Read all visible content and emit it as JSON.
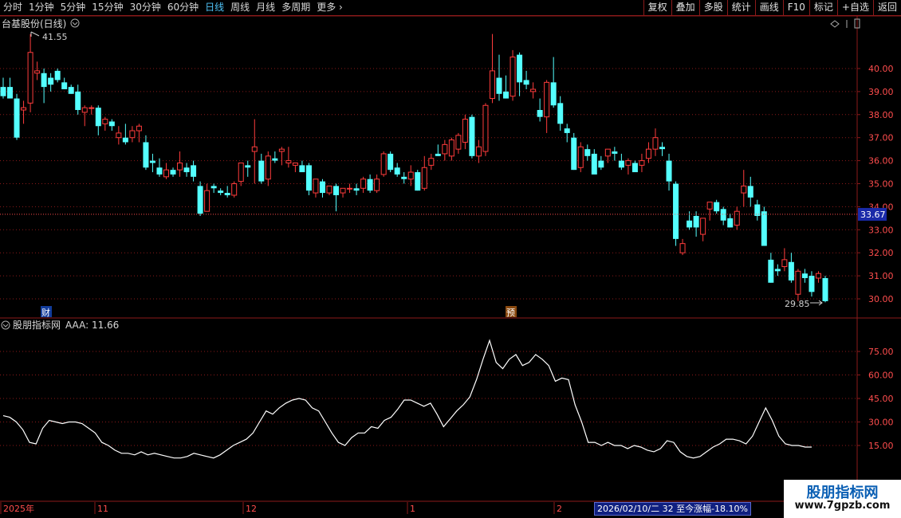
{
  "toolbar": {
    "periods": [
      "分时",
      "1分钟",
      "5分钟",
      "15分钟",
      "30分钟",
      "60分钟",
      "日线",
      "周线",
      "月线",
      "多周期",
      "更多"
    ],
    "active": "日线",
    "buttons": [
      "复权",
      "叠加",
      "多股",
      "统计",
      "画线",
      "F10",
      "标记",
      "+自选",
      "返回"
    ]
  },
  "main_chart": {
    "title": "台基股份(日线)",
    "max_label": "41.55",
    "min_label": "29.85",
    "current_price": "33.67",
    "flag_cai": "财",
    "flag_yu": "预"
  },
  "indicator": {
    "title": "股朋指标网",
    "value_label": "AAA: 11.66"
  },
  "xaxis": {
    "labels": [
      "2025年",
      "11",
      "12",
      "1",
      "2"
    ]
  },
  "status_text": "2026/02/10/二 32 至今涨幅-18.10%",
  "watermark": {
    "title": "股朋指标网",
    "url": "www.7gpzb.com"
  },
  "colors": {
    "up": "#ff3c3c",
    "down": "#54ffff",
    "grid": "#8b1a1a",
    "line": "#ffffff",
    "active_period": "#4fc3f7"
  },
  "chart_data": [
    {
      "type": "candlestick",
      "title": "台基股份(日线)",
      "ylim": [
        29.5,
        42.0
      ],
      "yticks": [
        "40.00",
        "39.00",
        "38.00",
        "37.00",
        "36.00",
        "35.00",
        "34.00",
        "33.00",
        "32.00",
        "31.00",
        "30.00"
      ],
      "candles": [
        {
          "o": 39.2,
          "h": 39.6,
          "l": 38.7,
          "c": 38.8
        },
        {
          "o": 39.2,
          "h": 39.6,
          "l": 38.9,
          "c": 38.7
        },
        {
          "o": 38.7,
          "h": 38.9,
          "l": 36.9,
          "c": 37.0
        },
        {
          "o": 38.2,
          "h": 38.6,
          "l": 37.6,
          "c": 38.3
        },
        {
          "o": 38.5,
          "h": 41.5,
          "l": 38.1,
          "c": 40.7
        },
        {
          "o": 39.8,
          "h": 40.3,
          "l": 39.5,
          "c": 39.9
        },
        {
          "o": 39.8,
          "h": 40.0,
          "l": 38.5,
          "c": 39.2
        },
        {
          "o": 39.6,
          "h": 39.8,
          "l": 39.0,
          "c": 39.3
        },
        {
          "o": 39.9,
          "h": 40.0,
          "l": 39.4,
          "c": 39.5
        },
        {
          "o": 39.4,
          "h": 39.6,
          "l": 39.1,
          "c": 39.1
        },
        {
          "o": 39.2,
          "h": 39.3,
          "l": 38.9,
          "c": 38.9
        },
        {
          "o": 39.0,
          "h": 39.3,
          "l": 38.0,
          "c": 38.2
        },
        {
          "o": 38.1,
          "h": 38.4,
          "l": 37.5,
          "c": 38.3
        },
        {
          "o": 38.3,
          "h": 38.4,
          "l": 38.0,
          "c": 38.3
        },
        {
          "o": 38.3,
          "h": 38.4,
          "l": 37.1,
          "c": 37.5
        },
        {
          "o": 37.6,
          "h": 37.9,
          "l": 37.3,
          "c": 37.8
        },
        {
          "o": 37.7,
          "h": 37.8,
          "l": 37.3,
          "c": 37.5
        },
        {
          "o": 37.0,
          "h": 37.5,
          "l": 36.7,
          "c": 37.2
        },
        {
          "o": 37.0,
          "h": 37.6,
          "l": 36.7,
          "c": 36.8
        },
        {
          "o": 37.0,
          "h": 37.5,
          "l": 36.8,
          "c": 37.3
        },
        {
          "o": 37.3,
          "h": 37.6,
          "l": 36.8,
          "c": 37.5
        },
        {
          "o": 36.8,
          "h": 37.1,
          "l": 35.6,
          "c": 35.7
        },
        {
          "o": 36.0,
          "h": 36.3,
          "l": 35.5,
          "c": 35.9
        },
        {
          "o": 35.7,
          "h": 36.1,
          "l": 35.3,
          "c": 35.4
        },
        {
          "o": 35.3,
          "h": 35.9,
          "l": 35.2,
          "c": 35.6
        },
        {
          "o": 35.6,
          "h": 35.7,
          "l": 35.3,
          "c": 35.4
        },
        {
          "o": 35.6,
          "h": 36.4,
          "l": 35.3,
          "c": 35.9
        },
        {
          "o": 35.7,
          "h": 35.9,
          "l": 35.3,
          "c": 35.5
        },
        {
          "o": 35.8,
          "h": 36.0,
          "l": 35.1,
          "c": 35.3
        },
        {
          "o": 34.9,
          "h": 35.1,
          "l": 33.6,
          "c": 33.7
        },
        {
          "o": 33.8,
          "h": 35.0,
          "l": 33.8,
          "c": 34.7
        },
        {
          "o": 34.9,
          "h": 35.0,
          "l": 34.6,
          "c": 34.8
        },
        {
          "o": 34.7,
          "h": 34.8,
          "l": 34.5,
          "c": 34.6
        },
        {
          "o": 34.6,
          "h": 34.9,
          "l": 34.4,
          "c": 34.5
        },
        {
          "o": 34.5,
          "h": 35.1,
          "l": 34.4,
          "c": 35.0
        },
        {
          "o": 35.1,
          "h": 35.9,
          "l": 34.9,
          "c": 35.9
        },
        {
          "o": 35.8,
          "h": 36.0,
          "l": 35.3,
          "c": 35.7
        },
        {
          "o": 36.4,
          "h": 37.8,
          "l": 35.0,
          "c": 36.6
        },
        {
          "o": 36.0,
          "h": 36.3,
          "l": 35.0,
          "c": 35.1
        },
        {
          "o": 35.2,
          "h": 36.4,
          "l": 34.9,
          "c": 36.2
        },
        {
          "o": 36.1,
          "h": 36.4,
          "l": 35.9,
          "c": 36.0
        },
        {
          "o": 36.4,
          "h": 36.6,
          "l": 35.8,
          "c": 36.5
        },
        {
          "o": 35.9,
          "h": 36.6,
          "l": 35.7,
          "c": 36.0
        },
        {
          "o": 35.8,
          "h": 35.9,
          "l": 35.5,
          "c": 35.9
        },
        {
          "o": 35.8,
          "h": 36.0,
          "l": 35.6,
          "c": 35.5
        },
        {
          "o": 35.8,
          "h": 35.9,
          "l": 34.5,
          "c": 34.7
        },
        {
          "o": 34.6,
          "h": 34.8,
          "l": 34.4,
          "c": 35.2
        },
        {
          "o": 35.1,
          "h": 35.2,
          "l": 34.4,
          "c": 34.6
        },
        {
          "o": 34.6,
          "h": 34.9,
          "l": 34.5,
          "c": 34.9
        },
        {
          "o": 34.9,
          "h": 35.0,
          "l": 33.8,
          "c": 34.5
        },
        {
          "o": 34.6,
          "h": 34.8,
          "l": 34.4,
          "c": 34.8
        },
        {
          "o": 34.8,
          "h": 35.0,
          "l": 34.6,
          "c": 34.8
        },
        {
          "o": 34.8,
          "h": 35.0,
          "l": 34.5,
          "c": 34.7
        },
        {
          "o": 34.8,
          "h": 35.3,
          "l": 34.6,
          "c": 35.2
        },
        {
          "o": 35.2,
          "h": 35.4,
          "l": 34.6,
          "c": 34.7
        },
        {
          "o": 34.7,
          "h": 35.4,
          "l": 34.6,
          "c": 35.2
        },
        {
          "o": 35.4,
          "h": 36.4,
          "l": 35.3,
          "c": 36.3
        },
        {
          "o": 36.3,
          "h": 36.4,
          "l": 35.5,
          "c": 35.6
        },
        {
          "o": 35.7,
          "h": 35.9,
          "l": 35.3,
          "c": 35.4
        },
        {
          "o": 35.3,
          "h": 35.5,
          "l": 35.0,
          "c": 35.2
        },
        {
          "o": 35.2,
          "h": 35.8,
          "l": 34.9,
          "c": 35.5
        },
        {
          "o": 35.5,
          "h": 35.6,
          "l": 34.7,
          "c": 34.7
        },
        {
          "o": 34.8,
          "h": 36.2,
          "l": 34.7,
          "c": 35.7
        },
        {
          "o": 35.8,
          "h": 36.3,
          "l": 35.6,
          "c": 36.1
        },
        {
          "o": 36.3,
          "h": 36.7,
          "l": 36.2,
          "c": 36.2
        },
        {
          "o": 36.3,
          "h": 36.9,
          "l": 36.0,
          "c": 36.7
        },
        {
          "o": 36.2,
          "h": 37.0,
          "l": 36.0,
          "c": 36.9
        },
        {
          "o": 36.5,
          "h": 37.2,
          "l": 36.3,
          "c": 37.1
        },
        {
          "o": 36.8,
          "h": 38.0,
          "l": 36.5,
          "c": 37.8
        },
        {
          "o": 37.9,
          "h": 38.0,
          "l": 36.1,
          "c": 36.2
        },
        {
          "o": 36.2,
          "h": 36.9,
          "l": 35.9,
          "c": 36.6
        },
        {
          "o": 36.4,
          "h": 38.5,
          "l": 36.2,
          "c": 38.4
        },
        {
          "o": 38.7,
          "h": 41.5,
          "l": 38.5,
          "c": 39.9
        },
        {
          "o": 39.6,
          "h": 40.6,
          "l": 38.6,
          "c": 38.9
        },
        {
          "o": 39.0,
          "h": 39.7,
          "l": 38.7,
          "c": 38.7
        },
        {
          "o": 38.8,
          "h": 40.8,
          "l": 38.6,
          "c": 40.5
        },
        {
          "o": 40.6,
          "h": 40.7,
          "l": 38.8,
          "c": 39.4
        },
        {
          "o": 39.5,
          "h": 39.9,
          "l": 39.1,
          "c": 39.3
        },
        {
          "o": 39.0,
          "h": 39.4,
          "l": 38.7,
          "c": 39.1
        },
        {
          "o": 38.2,
          "h": 38.7,
          "l": 37.7,
          "c": 37.9
        },
        {
          "o": 37.9,
          "h": 39.5,
          "l": 37.2,
          "c": 39.4
        },
        {
          "o": 39.4,
          "h": 40.5,
          "l": 38.3,
          "c": 38.4
        },
        {
          "o": 38.5,
          "h": 38.8,
          "l": 37.3,
          "c": 37.6
        },
        {
          "o": 37.4,
          "h": 37.6,
          "l": 36.8,
          "c": 37.2
        },
        {
          "o": 37.0,
          "h": 37.2,
          "l": 35.6,
          "c": 35.6
        },
        {
          "o": 35.7,
          "h": 36.8,
          "l": 35.5,
          "c": 36.6
        },
        {
          "o": 36.5,
          "h": 36.7,
          "l": 36.0,
          "c": 36.2
        },
        {
          "o": 36.3,
          "h": 36.5,
          "l": 35.5,
          "c": 35.4
        },
        {
          "o": 36.0,
          "h": 36.2,
          "l": 35.6,
          "c": 35.7
        },
        {
          "o": 36.2,
          "h": 36.5,
          "l": 35.9,
          "c": 36.5
        },
        {
          "o": 36.4,
          "h": 36.6,
          "l": 36.0,
          "c": 36.3
        },
        {
          "o": 36.0,
          "h": 36.3,
          "l": 35.6,
          "c": 35.7
        },
        {
          "o": 35.8,
          "h": 36.1,
          "l": 35.4,
          "c": 36.0
        },
        {
          "o": 35.9,
          "h": 36.0,
          "l": 35.6,
          "c": 35.5
        },
        {
          "o": 35.8,
          "h": 36.3,
          "l": 35.5,
          "c": 36.0
        },
        {
          "o": 36.1,
          "h": 36.8,
          "l": 35.9,
          "c": 36.5
        },
        {
          "o": 36.5,
          "h": 37.4,
          "l": 36.2,
          "c": 37.0
        },
        {
          "o": 36.6,
          "h": 36.8,
          "l": 36.2,
          "c": 36.5
        },
        {
          "o": 36.0,
          "h": 36.3,
          "l": 34.7,
          "c": 35.1
        },
        {
          "o": 35.0,
          "h": 35.1,
          "l": 32.3,
          "c": 32.6
        },
        {
          "o": 32.0,
          "h": 32.6,
          "l": 31.9,
          "c": 32.4
        },
        {
          "o": 33.4,
          "h": 33.8,
          "l": 33.0,
          "c": 33.1
        },
        {
          "o": 33.6,
          "h": 33.8,
          "l": 32.7,
          "c": 33.1
        },
        {
          "o": 32.8,
          "h": 33.4,
          "l": 32.5,
          "c": 33.5
        },
        {
          "o": 33.9,
          "h": 34.1,
          "l": 33.4,
          "c": 34.2
        },
        {
          "o": 34.2,
          "h": 34.3,
          "l": 33.7,
          "c": 33.8
        },
        {
          "o": 33.9,
          "h": 34.0,
          "l": 33.2,
          "c": 33.4
        },
        {
          "o": 33.5,
          "h": 33.7,
          "l": 33.1,
          "c": 33.1
        },
        {
          "o": 33.2,
          "h": 34.0,
          "l": 33.0,
          "c": 33.8
        },
        {
          "o": 34.6,
          "h": 35.6,
          "l": 34.0,
          "c": 34.9
        },
        {
          "o": 34.9,
          "h": 35.3,
          "l": 34.0,
          "c": 34.4
        },
        {
          "o": 34.1,
          "h": 34.3,
          "l": 33.4,
          "c": 33.6
        },
        {
          "o": 33.8,
          "h": 34.0,
          "l": 32.3,
          "c": 32.3
        },
        {
          "o": 31.7,
          "h": 32.0,
          "l": 30.7,
          "c": 30.7
        },
        {
          "o": 31.3,
          "h": 31.5,
          "l": 31.0,
          "c": 31.2
        },
        {
          "o": 31.4,
          "h": 32.2,
          "l": 31.2,
          "c": 31.7
        },
        {
          "o": 31.6,
          "h": 32.0,
          "l": 30.7,
          "c": 30.8
        },
        {
          "o": 30.2,
          "h": 31.3,
          "l": 29.9,
          "c": 31.2
        },
        {
          "o": 31.1,
          "h": 31.3,
          "l": 30.7,
          "c": 30.9
        },
        {
          "o": 31.0,
          "h": 31.2,
          "l": 30.1,
          "c": 30.3
        },
        {
          "o": 30.9,
          "h": 31.2,
          "l": 30.7,
          "c": 31.1
        },
        {
          "o": 30.9,
          "h": 31.0,
          "l": 29.85,
          "c": 29.9
        }
      ]
    },
    {
      "type": "line",
      "title": "股朋指标网",
      "series": [
        {
          "name": "AAA",
          "values": [
            34,
            33,
            30,
            25,
            17,
            16,
            26,
            31,
            30,
            29,
            30,
            30,
            29,
            26,
            23,
            17,
            15,
            12,
            10,
            10,
            9,
            11,
            9,
            10,
            9,
            8,
            7,
            7,
            8,
            10,
            9,
            8,
            7,
            9,
            12,
            15,
            17,
            19,
            23,
            30,
            37,
            35,
            39,
            42,
            44,
            45,
            44,
            39,
            37,
            30,
            23,
            17,
            15,
            20,
            23,
            23,
            27,
            26,
            31,
            33,
            38,
            44,
            44,
            42,
            40,
            42,
            35,
            27,
            32,
            37,
            41,
            46,
            57,
            70,
            82,
            68,
            64,
            70,
            73,
            66,
            68,
            73,
            70,
            66,
            56,
            58,
            57,
            41,
            30,
            17,
            17,
            15,
            17,
            15,
            15,
            13,
            15,
            14,
            12,
            11,
            13,
            18,
            17,
            11,
            8,
            7,
            8,
            11,
            14,
            16,
            19,
            19,
            18,
            16,
            21,
            30,
            39,
            31,
            21,
            16,
            15,
            15,
            14,
            14
          ]
        }
      ],
      "ylim": [
        10,
        90
      ],
      "yticks": [
        "75.00",
        "60.00",
        "45.00",
        "30.00",
        "15.00"
      ]
    }
  ]
}
